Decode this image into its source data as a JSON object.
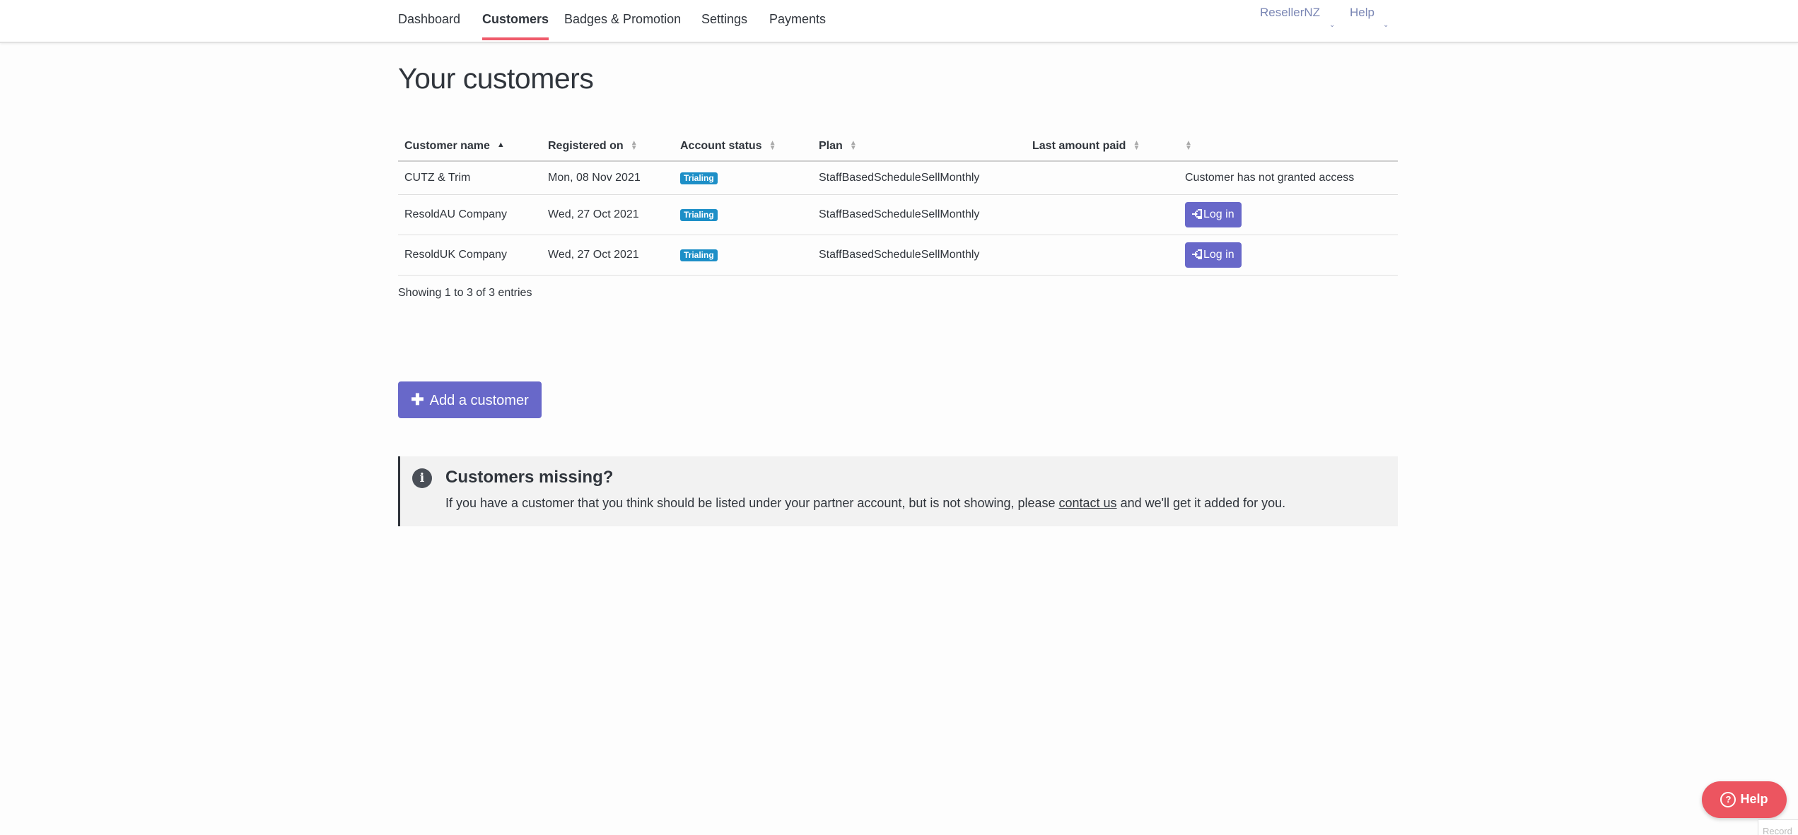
{
  "nav": {
    "items": [
      {
        "label": "Dashboard"
      },
      {
        "label": "Customers"
      },
      {
        "label": "Badges & Promotion"
      },
      {
        "label": "Settings"
      },
      {
        "label": "Payments"
      }
    ],
    "account_label": "ResellerNZ",
    "help_label": "Help"
  },
  "page": {
    "title": "Your customers"
  },
  "table": {
    "headers": [
      "Customer name",
      "Registered on",
      "Account status",
      "Plan",
      "Last amount paid",
      ""
    ],
    "rows": [
      {
        "name": "CUTZ & Trim",
        "registered": "Mon, 08 Nov 2021",
        "status": "Trialing",
        "plan": "StaffBasedScheduleSellMonthly",
        "last_paid": "",
        "action": "Customer has not granted access"
      },
      {
        "name": "ResoldAU Company",
        "registered": "Wed, 27 Oct 2021",
        "status": "Trialing",
        "plan": "StaffBasedScheduleSellMonthly",
        "last_paid": "",
        "action": "Log in"
      },
      {
        "name": "ResoldUK Company",
        "registered": "Wed, 27 Oct 2021",
        "status": "Trialing",
        "plan": "StaffBasedScheduleSellMonthly",
        "last_paid": "",
        "action": "Log in"
      }
    ],
    "entries_info": "Showing 1 to 3 of 3 entries"
  },
  "add_button": {
    "label": "Add a customer"
  },
  "notice": {
    "title": "Customers missing?",
    "text_before": "If you have a customer that you think should be listed under your partner account, but is not showing, please ",
    "link": "contact us",
    "text_after": " and we'll get it added for you."
  },
  "help_fab": {
    "label": "Help"
  },
  "record_tab": {
    "label": "Record"
  },
  "colors": {
    "accent": "#6868c9",
    "active_tab": "#ef5a6a",
    "badge": "#1d8fc7",
    "help": "#ec5560"
  }
}
